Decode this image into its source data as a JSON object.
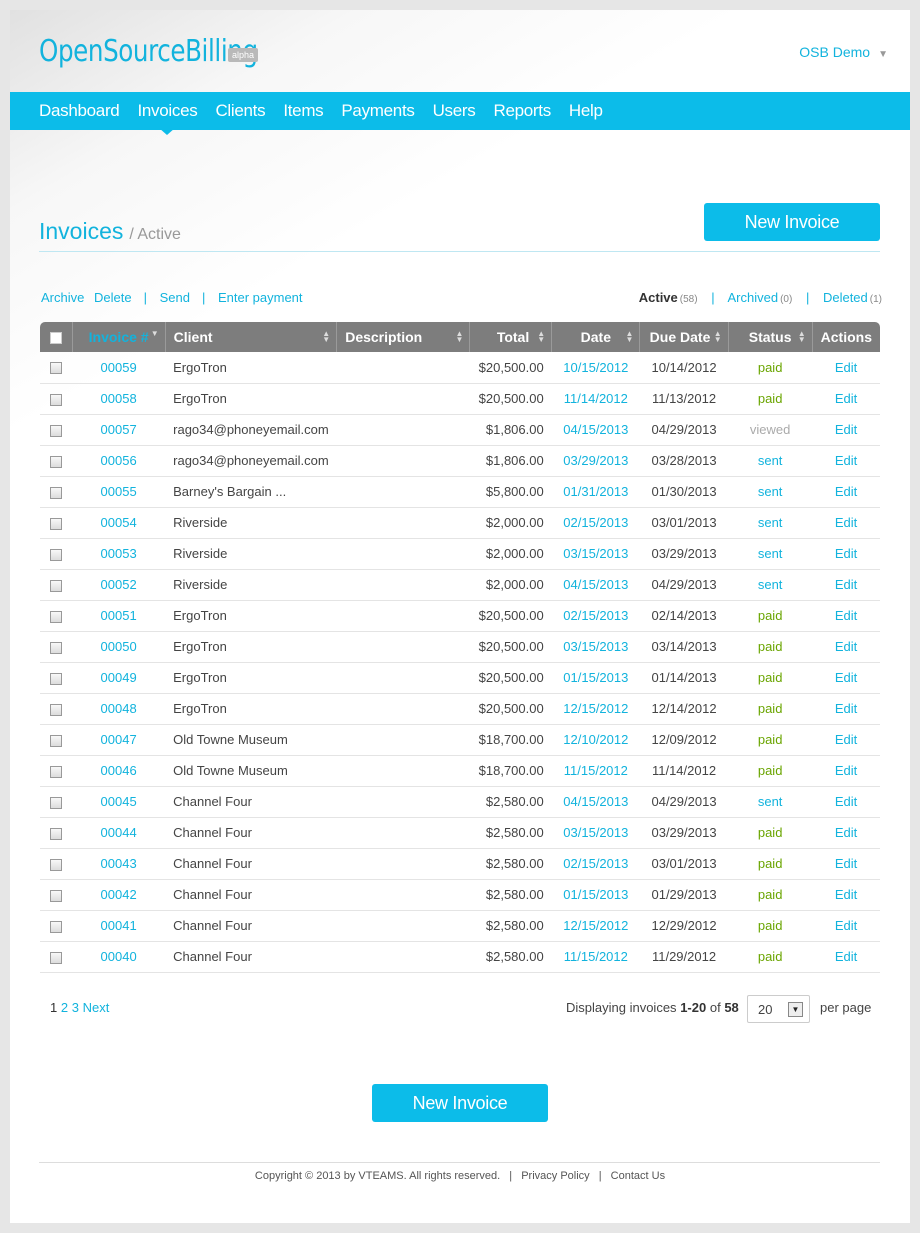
{
  "brand": {
    "logo": "OpenSourceBilling",
    "badge": "alpha"
  },
  "user_menu": {
    "label": "OSB Demo"
  },
  "nav": [
    {
      "label": "Dashboard",
      "active": false
    },
    {
      "label": "Invoices",
      "active": true
    },
    {
      "label": "Clients",
      "active": false
    },
    {
      "label": "Items",
      "active": false
    },
    {
      "label": "Payments",
      "active": false
    },
    {
      "label": "Users",
      "active": false
    },
    {
      "label": "Reports",
      "active": false
    },
    {
      "label": "Help",
      "active": false
    }
  ],
  "page": {
    "title": "Invoices",
    "subtitle": "/ Active",
    "new_invoice_label": "New Invoice"
  },
  "bulk_actions": {
    "archive": "Archive",
    "delete": "Delete",
    "send": "Send",
    "enter_payment": "Enter payment"
  },
  "filters": {
    "active": {
      "label": "Active",
      "count": "(58)"
    },
    "archived": {
      "label": "Archived",
      "count": "(0)"
    },
    "deleted": {
      "label": "Deleted",
      "count": "(1)"
    }
  },
  "table": {
    "columns": [
      "Invoice #",
      "Client",
      "Description",
      "Total",
      "Date",
      "Due Date",
      "Status",
      "Actions"
    ],
    "rows": [
      [
        "00059",
        "ErgoTron",
        "",
        "$20,500.00",
        "10/15/2012",
        "10/14/2012",
        "paid",
        "Edit"
      ],
      [
        "00058",
        "ErgoTron",
        "",
        "$20,500.00",
        "11/14/2012",
        "11/13/2012",
        "paid",
        "Edit"
      ],
      [
        "00057",
        "rago34@phoneyemail.com",
        "",
        "$1,806.00",
        "04/15/2013",
        "04/29/2013",
        "viewed",
        "Edit"
      ],
      [
        "00056",
        "rago34@phoneyemail.com",
        "",
        "$1,806.00",
        "03/29/2013",
        "03/28/2013",
        "sent",
        "Edit"
      ],
      [
        "00055",
        "Barney's Bargain ...",
        "",
        "$5,800.00",
        "01/31/2013",
        "01/30/2013",
        "sent",
        "Edit"
      ],
      [
        "00054",
        "Riverside",
        "",
        "$2,000.00",
        "02/15/2013",
        "03/01/2013",
        "sent",
        "Edit"
      ],
      [
        "00053",
        "Riverside",
        "",
        "$2,000.00",
        "03/15/2013",
        "03/29/2013",
        "sent",
        "Edit"
      ],
      [
        "00052",
        "Riverside",
        "",
        "$2,000.00",
        "04/15/2013",
        "04/29/2013",
        "sent",
        "Edit"
      ],
      [
        "00051",
        "ErgoTron",
        "",
        "$20,500.00",
        "02/15/2013",
        "02/14/2013",
        "paid",
        "Edit"
      ],
      [
        "00050",
        "ErgoTron",
        "",
        "$20,500.00",
        "03/15/2013",
        "03/14/2013",
        "paid",
        "Edit"
      ],
      [
        "00049",
        "ErgoTron",
        "",
        "$20,500.00",
        "01/15/2013",
        "01/14/2013",
        "paid",
        "Edit"
      ],
      [
        "00048",
        "ErgoTron",
        "",
        "$20,500.00",
        "12/15/2012",
        "12/14/2012",
        "paid",
        "Edit"
      ],
      [
        "00047",
        "Old Towne Museum",
        "",
        "$18,700.00",
        "12/10/2012",
        "12/09/2012",
        "paid",
        "Edit"
      ],
      [
        "00046",
        "Old Towne Museum",
        "",
        "$18,700.00",
        "11/15/2012",
        "11/14/2012",
        "paid",
        "Edit"
      ],
      [
        "00045",
        "Channel Four",
        "",
        "$2,580.00",
        "04/15/2013",
        "04/29/2013",
        "sent",
        "Edit"
      ],
      [
        "00044",
        "Channel Four",
        "",
        "$2,580.00",
        "03/15/2013",
        "03/29/2013",
        "paid",
        "Edit"
      ],
      [
        "00043",
        "Channel Four",
        "",
        "$2,580.00",
        "02/15/2013",
        "03/01/2013",
        "paid",
        "Edit"
      ],
      [
        "00042",
        "Channel Four",
        "",
        "$2,580.00",
        "01/15/2013",
        "01/29/2013",
        "paid",
        "Edit"
      ],
      [
        "00041",
        "Channel Four",
        "",
        "$2,580.00",
        "12/15/2012",
        "12/29/2012",
        "paid",
        "Edit"
      ],
      [
        "00040",
        "Channel Four",
        "",
        "$2,580.00",
        "11/15/2012",
        "11/29/2012",
        "paid",
        "Edit"
      ]
    ]
  },
  "pagination": {
    "current": "1",
    "pages": [
      "2",
      "3"
    ],
    "next": "Next"
  },
  "display": {
    "prefix": "Displaying invoices",
    "range": "1-20",
    "of": "of",
    "total": "58",
    "per_page_value": "20",
    "per_page_label": "per page"
  },
  "footer": {
    "copyright": "Copyright © 2013 by VTEAMS. All rights reserved.",
    "privacy": "Privacy Policy",
    "contact": "Contact Us"
  },
  "colors": {
    "accent": "#0cbce9",
    "paid": "#6aa500",
    "sent": "#12b3dd",
    "viewed": "#aaaaaa",
    "header_bg": "#7d7d7d"
  }
}
